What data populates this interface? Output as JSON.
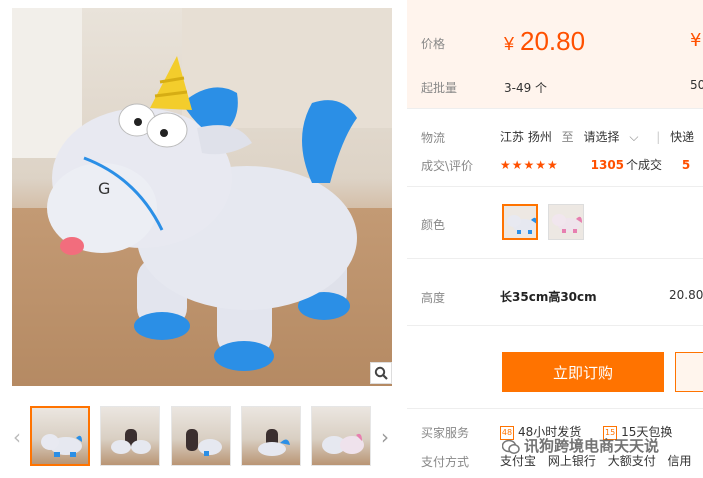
{
  "price": {
    "label": "价格",
    "currency": "¥",
    "value": "20.80",
    "next_currency": "¥"
  },
  "moq": {
    "label": "起批量",
    "value": "3-49 个",
    "next_value": "50"
  },
  "logistics": {
    "label": "物流",
    "origin": "江苏 扬州",
    "to": "至",
    "destination": "请选择",
    "method": "快递",
    "method_currency": "¥"
  },
  "rating": {
    "label": "成交\\评价",
    "stars": "★★★★★",
    "deal_count": "1305",
    "deal_suffix": "个成交",
    "next_value": "5"
  },
  "color": {
    "label": "颜色",
    "options": [
      "unicorn-variant-1",
      "unicorn-variant-2"
    ],
    "selected_index": 0
  },
  "size": {
    "label": "高度",
    "value": "长35cm高30cm",
    "price": "20.80"
  },
  "order": {
    "button_label": "立即订购"
  },
  "services": {
    "label": "买家服务",
    "items": [
      {
        "badge": "48",
        "text": "48小时发货"
      },
      {
        "badge": "15",
        "text": "15天包换"
      }
    ]
  },
  "payment": {
    "label": "支付方式",
    "methods": [
      "支付宝",
      "网上银行",
      "大额支付",
      "信用"
    ]
  },
  "watermark": {
    "text": "讯狗跨境电商天天说"
  },
  "gallery": {
    "selected_thumb": 0,
    "thumb_count": 5
  },
  "colors": {
    "accent": "#ff7300",
    "price": "#ff5000",
    "price_bg": "#fff4ed",
    "unicorn_body": "#e3e5ee",
    "unicorn_blue": "#2b8fe6",
    "horn": "#f3cd2c"
  }
}
